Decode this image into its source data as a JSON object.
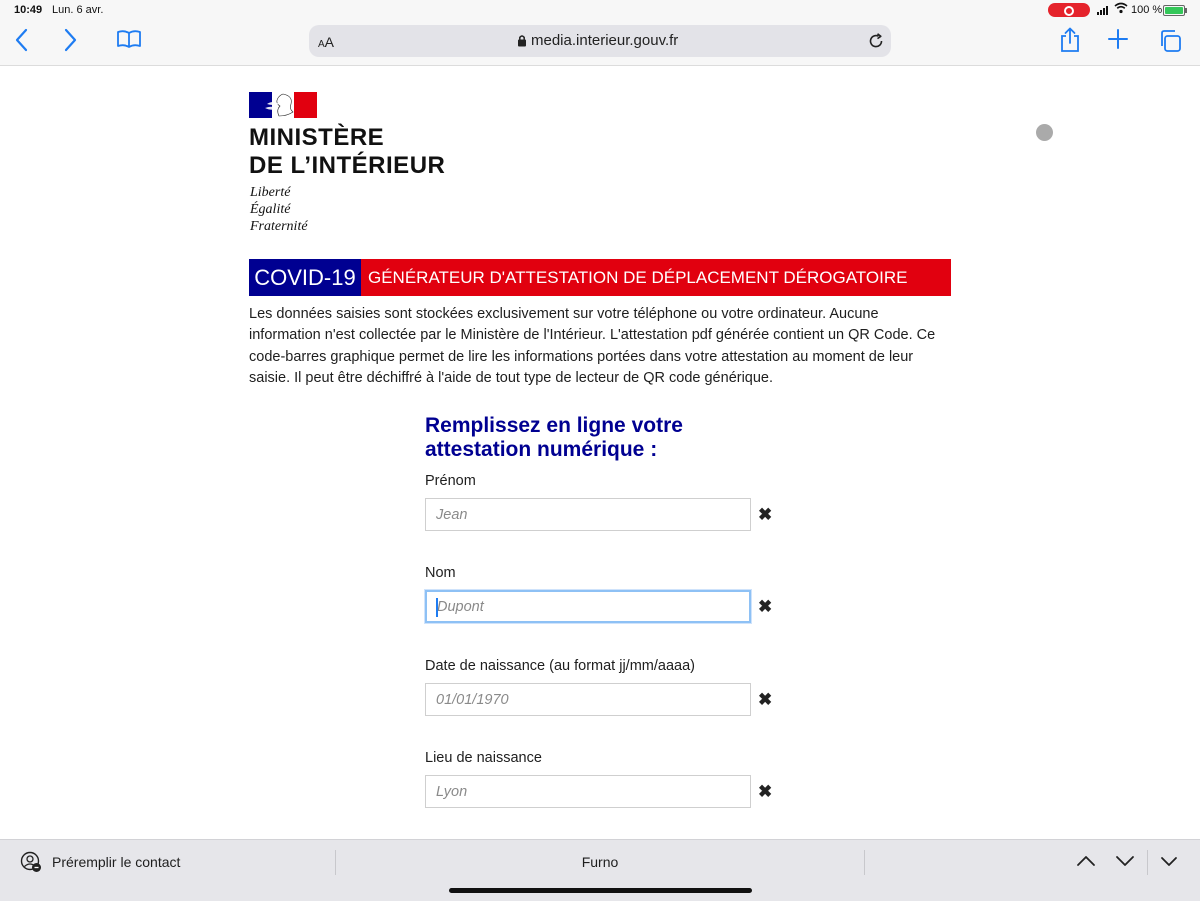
{
  "status_bar": {
    "time": "10:49",
    "date": "Lun. 6 avr.",
    "battery": "100 %"
  },
  "browser": {
    "aa_label": "AA",
    "url": "media.interieur.gouv.fr",
    "accent_color": "#1e7cf2"
  },
  "logo": {
    "title_line1": "MINISTÈRE",
    "title_line2": "DE L’INTÉRIEUR",
    "motto": [
      "Liberté",
      "Égalité",
      "Fraternité"
    ]
  },
  "banner": {
    "covid": "COVID-19",
    "title": "GÉNÉRATEUR D'ATTESTATION DE DÉPLACEMENT DÉROGATOIRE",
    "blue": "#000091",
    "red": "#e1000f"
  },
  "intro_text": "Les données saisies sont stockées exclusivement sur votre téléphone ou votre ordinateur. Aucune information n'est collectée par le Ministère de l'Intérieur. L'attestation pdf générée contient un QR Code. Ce code-barres graphique permet de lire les informations portées dans votre attestation au moment de leur saisie. Il peut être déchiffré à l'aide de tout type de lecteur de QR code générique.",
  "form": {
    "title_line1": "Remplissez en ligne votre",
    "title_line2": "attestation numérique :",
    "fields": [
      {
        "label": "Prénom",
        "placeholder": "Jean",
        "value": ""
      },
      {
        "label": "Nom",
        "placeholder": "Dupont",
        "value": "",
        "focused": true
      },
      {
        "label": "Date de naissance (au format jj/mm/aaaa)",
        "placeholder": "01/01/1970",
        "value": ""
      },
      {
        "label": "Lieu de naissance",
        "placeholder": "Lyon",
        "value": ""
      }
    ],
    "clear_symbol": "✖"
  },
  "keyboard_bar": {
    "prefill_contact": "Préremplir le contact",
    "suggestion": "Furno"
  }
}
